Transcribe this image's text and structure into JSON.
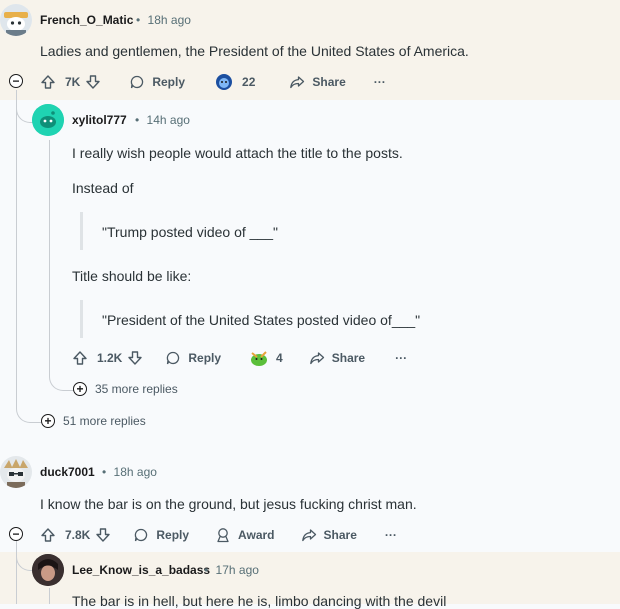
{
  "comments": [
    {
      "username": "French_O_Matic",
      "time": "18h ago",
      "body": "Ladies and gentlemen, the President of the United States of America.",
      "upvotes": "7K",
      "reply": "Reply",
      "award_count": "22",
      "share": "Share",
      "more": "···",
      "highlight": "#f7f3eb"
    },
    {
      "username": "xylitol777",
      "time": "14h ago",
      "body_lines": [
        "I really wish people would attach the title to the posts.",
        "Instead of"
      ],
      "quote1": "\"Trump posted video of ___\"",
      "title_line": "Title should be like:",
      "quote2": "\"President of the United States posted video of___\"",
      "upvotes": "1.2K",
      "reply": "Reply",
      "award_count": "4",
      "share": "Share",
      "more": "···",
      "more_replies": "35 more replies"
    },
    {
      "more_replies": "51 more replies"
    },
    {
      "username": "duck7001",
      "time": "18h ago",
      "body": "I know the bar is on the ground, but jesus fucking christ man.",
      "upvotes": "7.8K",
      "reply": "Reply",
      "award": "Award",
      "share": "Share",
      "more": "···"
    },
    {
      "username": "Lee_Know_is_a_badass",
      "time": "17h ago",
      "body": "The bar is in hell, but here he is, limbo dancing with the devil",
      "highlight": "#f7f3eb"
    }
  ],
  "separator": "•",
  "collapse_symbol": "−",
  "expand_symbol": "+",
  "colors": {
    "accent": "#0079d3",
    "thread": "#c9cdd2",
    "text": "#2a3236",
    "meta": "#576f76"
  },
  "icons": [
    "upvote-icon",
    "downvote-icon",
    "reply-icon",
    "award-icon",
    "share-icon",
    "collapse-icon",
    "expand-icon"
  ]
}
